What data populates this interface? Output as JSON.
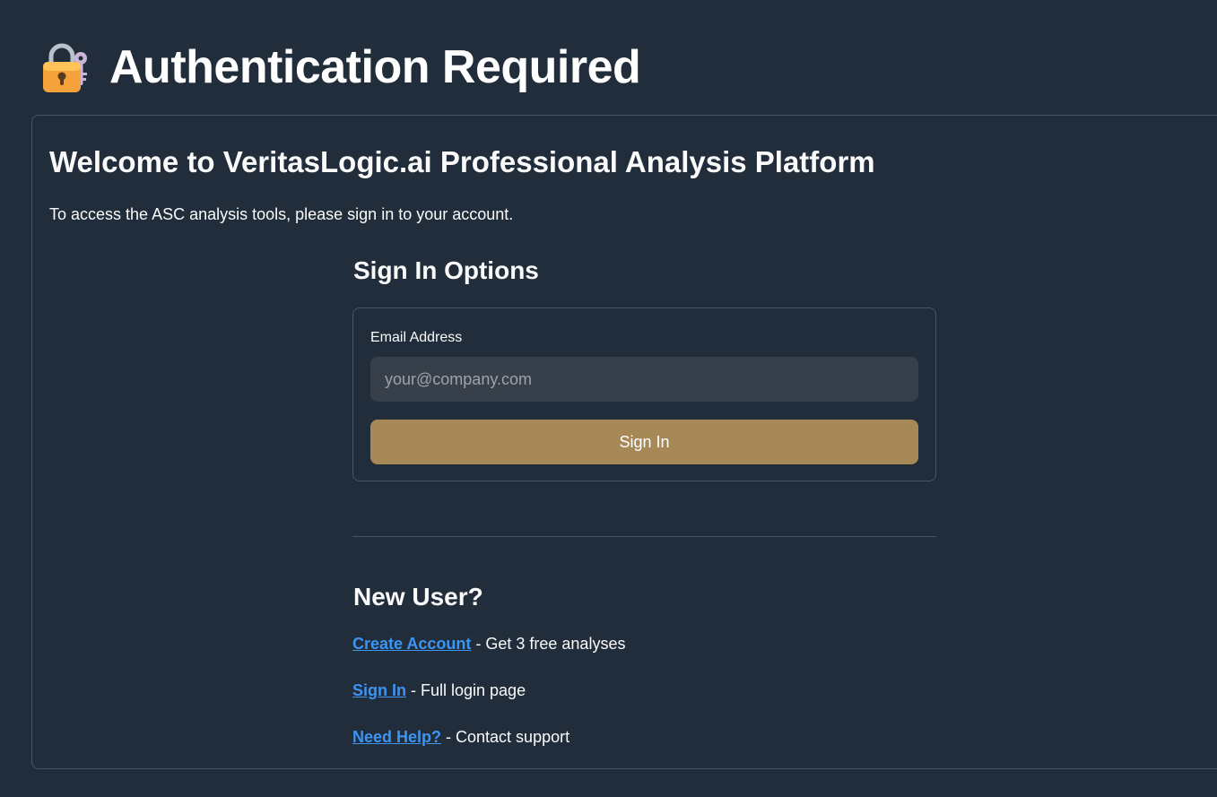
{
  "header": {
    "title": "Authentication Required",
    "icon": "lock-with-key-icon"
  },
  "welcome": {
    "heading": "Welcome to VeritasLogic.ai Professional Analysis Platform",
    "intro": "To access the ASC analysis tools, please sign in to your account."
  },
  "sign_in": {
    "heading": "Sign In Options",
    "email_label": "Email Address",
    "email_placeholder": "your@company.com",
    "email_value": "",
    "button_label": "Sign In"
  },
  "new_user": {
    "heading": "New User?",
    "links": [
      {
        "label": "Create Account",
        "description": " - Get 3 free analyses"
      },
      {
        "label": "Sign In",
        "description": " - Full login page"
      },
      {
        "label": "Need Help?",
        "description": " - Contact support"
      }
    ]
  },
  "colors": {
    "background": "#212d3b",
    "accent_button": "#a68957",
    "link": "#3b95f5",
    "input_background": "#363f4a",
    "border": "#4a5563"
  }
}
